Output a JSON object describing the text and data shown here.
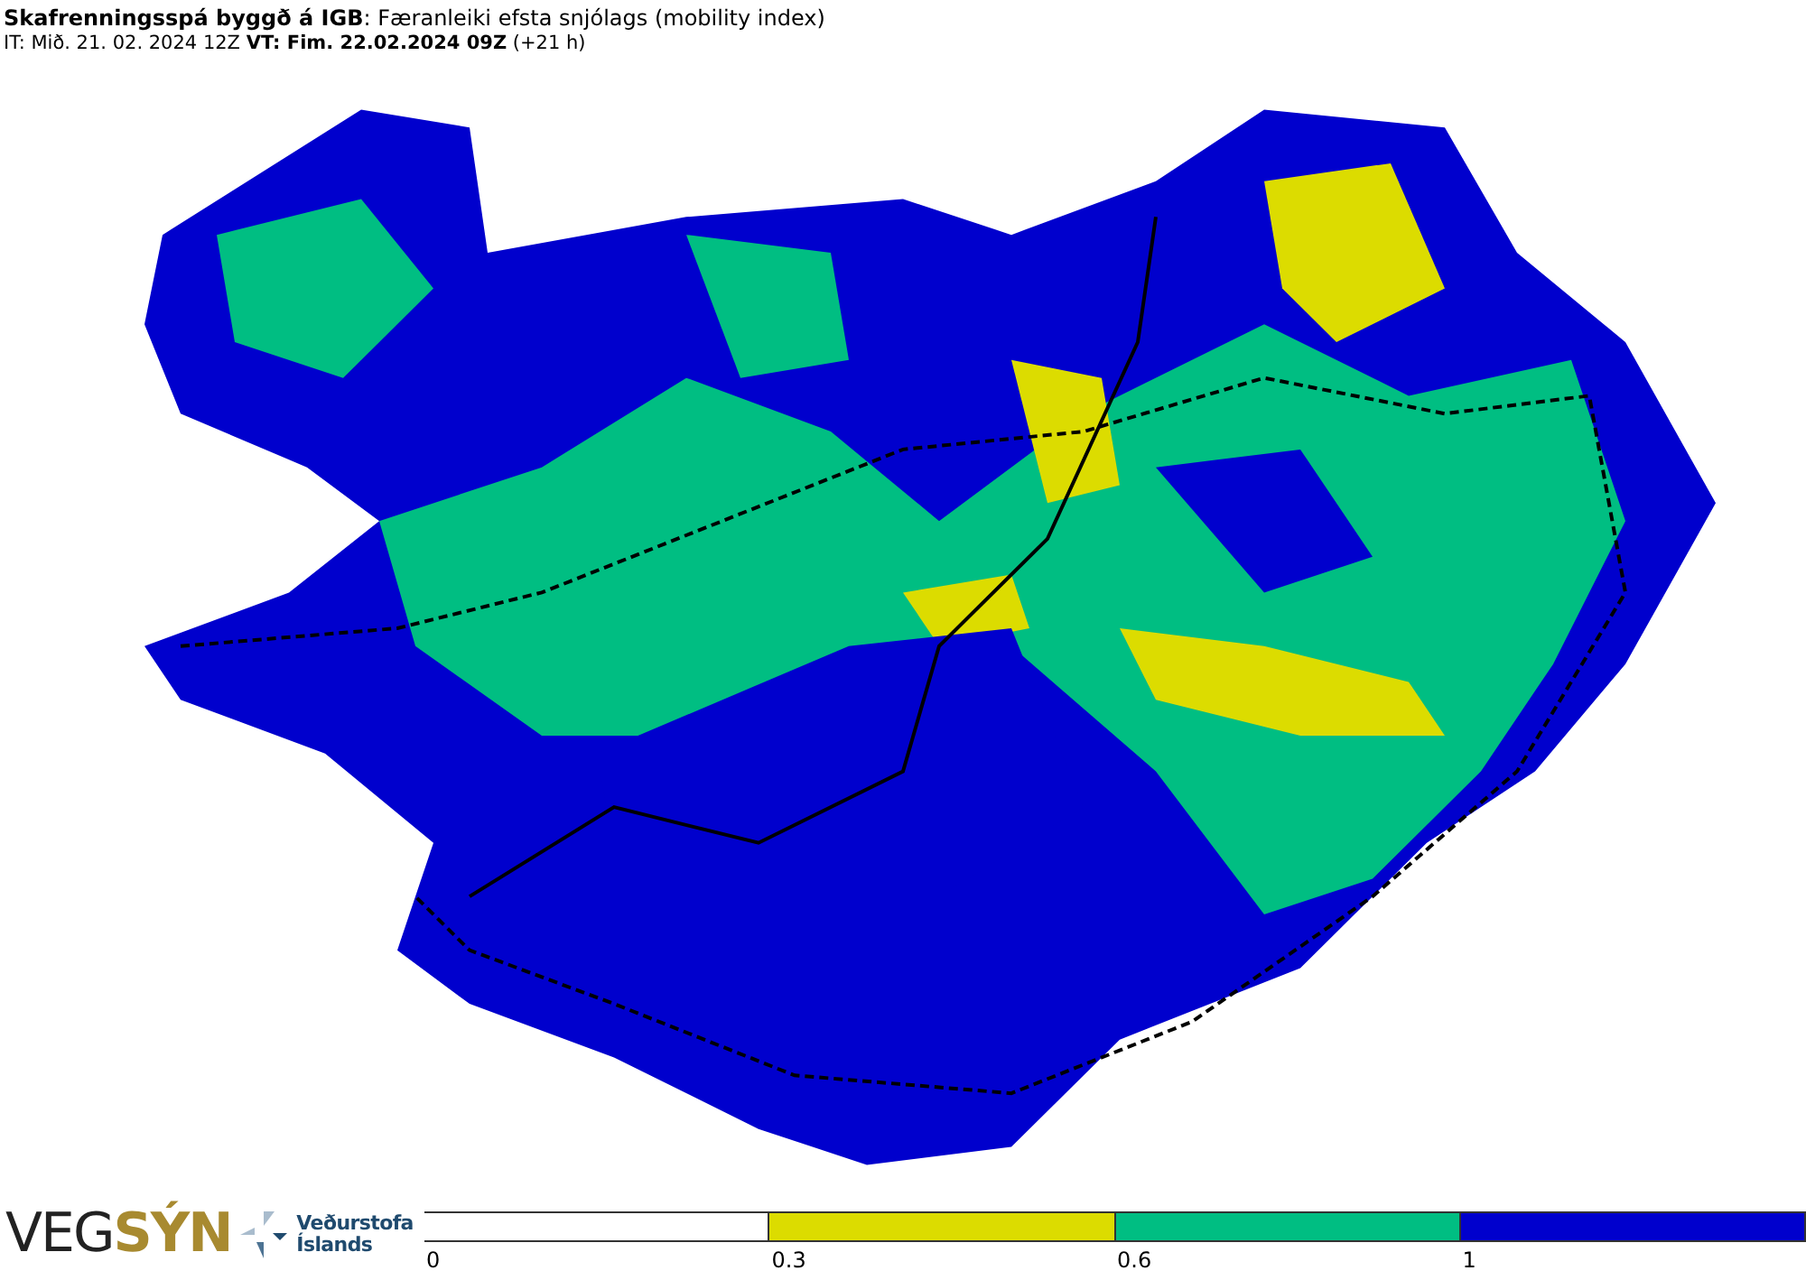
{
  "header": {
    "title": "**Skafrenningsspá byggð á IGB**: Færanleiki efsta snjólags (mobility index)",
    "subtitle": "IT: Mið. 21. 02. 2024 12Z **VT: Fim. 22.02.2024 09Z** (+21 h)"
  },
  "logos": {
    "vegsyn": [
      "VEG",
      "SÝN"
    ],
    "vedurstofa": [
      "Veðurstofa",
      "Íslands"
    ]
  },
  "legend": [
    {
      "label": "0",
      "color": "#ffffff"
    },
    {
      "label": "0.3",
      "color": "#dcdc00"
    },
    {
      "label": "0.6",
      "color": "#00be82"
    },
    {
      "label": "1",
      "color": "#0000cd"
    }
  ]
}
